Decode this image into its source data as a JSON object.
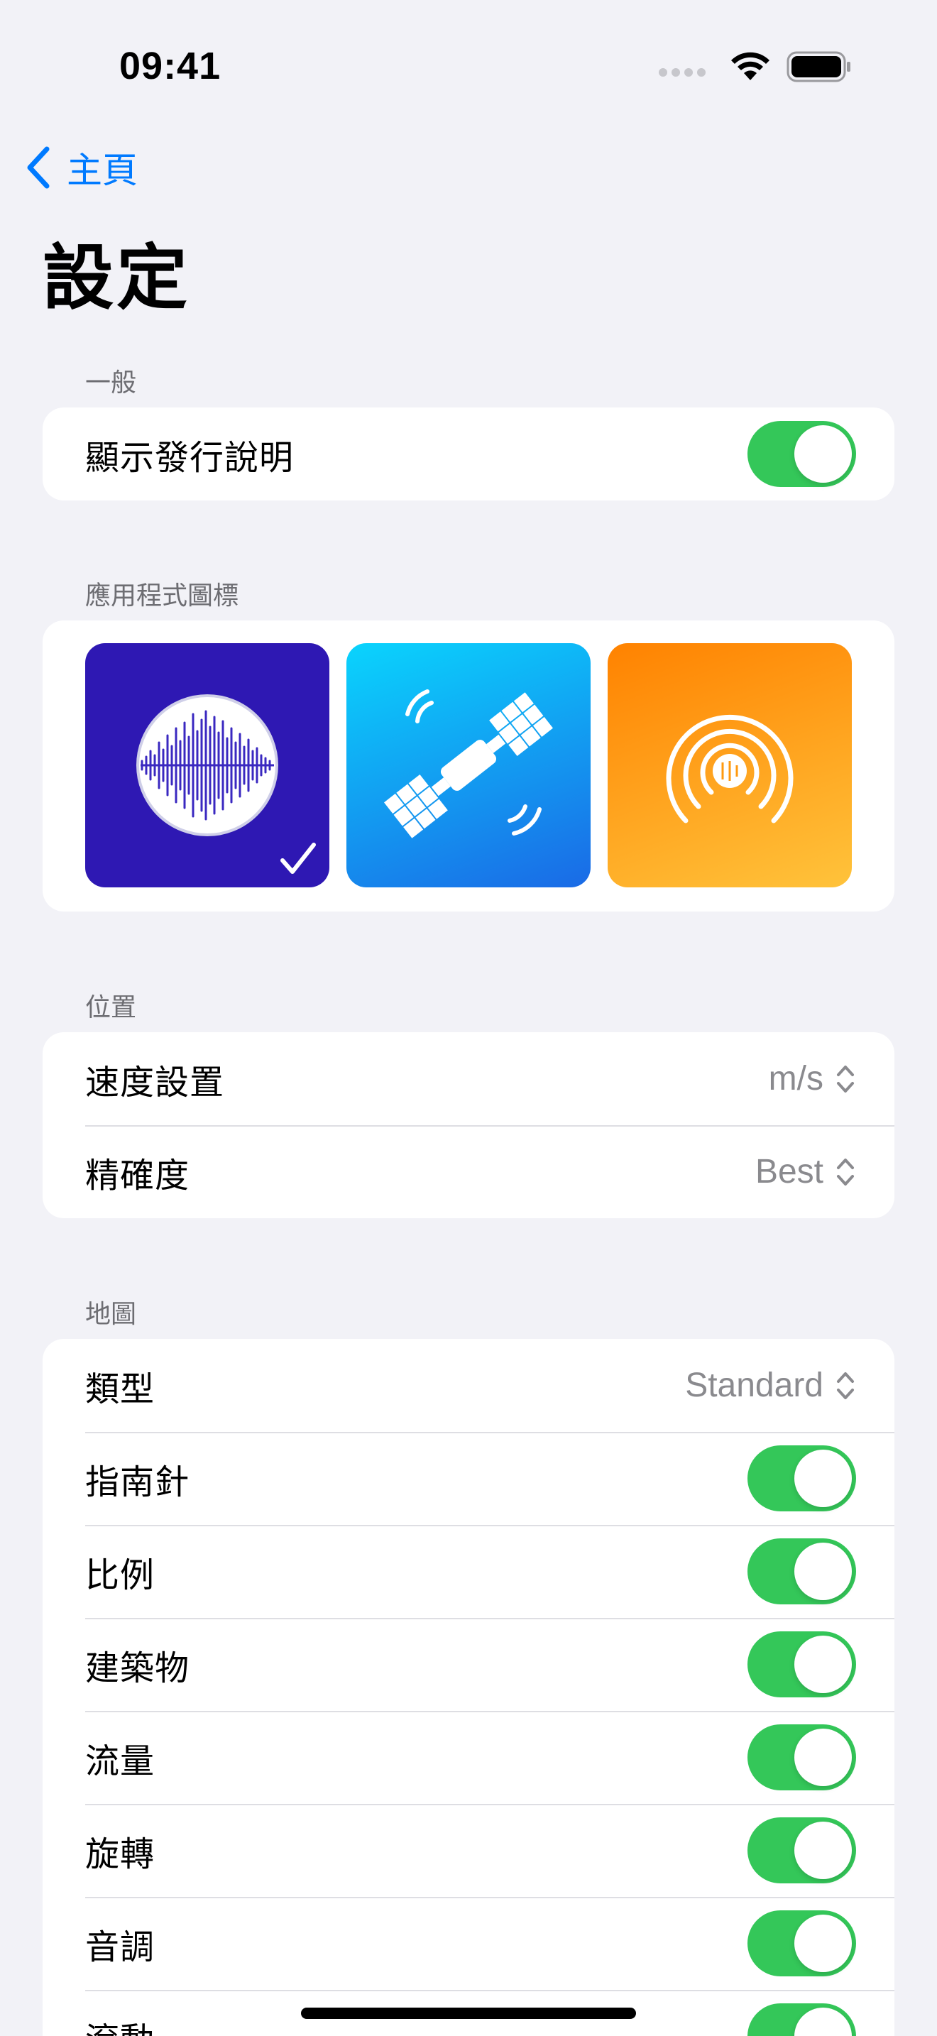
{
  "status_bar": {
    "time": "09:41"
  },
  "nav": {
    "back_label": "主頁",
    "title": "設定"
  },
  "sections": {
    "general": {
      "header": "一般",
      "rows": [
        {
          "label": "顯示發行說明",
          "toggle": true
        }
      ]
    },
    "app_icon": {
      "header": "應用程式圖標",
      "icons": [
        {
          "name": "waveform",
          "selected": true,
          "color": "#2e18b3"
        },
        {
          "name": "satellite",
          "selected": false,
          "color": "#0aa4f5"
        },
        {
          "name": "airtag-radar",
          "selected": false,
          "color": "#ff9a10"
        }
      ]
    },
    "location": {
      "header": "位置",
      "rows": [
        {
          "label": "速度設置",
          "value": "m/s"
        },
        {
          "label": "精確度",
          "value": "Best"
        }
      ]
    },
    "map": {
      "header": "地圖",
      "rows": [
        {
          "label": "類型",
          "value": "Standard"
        },
        {
          "label": "指南針",
          "toggle": true
        },
        {
          "label": "比例",
          "toggle": true
        },
        {
          "label": "建築物",
          "toggle": true
        },
        {
          "label": "流量",
          "toggle": true
        },
        {
          "label": "旋轉",
          "toggle": true
        },
        {
          "label": "音調",
          "toggle": true
        },
        {
          "label": "滾動",
          "toggle": true
        }
      ]
    }
  },
  "colors": {
    "accent": "#007aff",
    "toggle_on": "#34c759",
    "background": "#f2f2f7"
  }
}
